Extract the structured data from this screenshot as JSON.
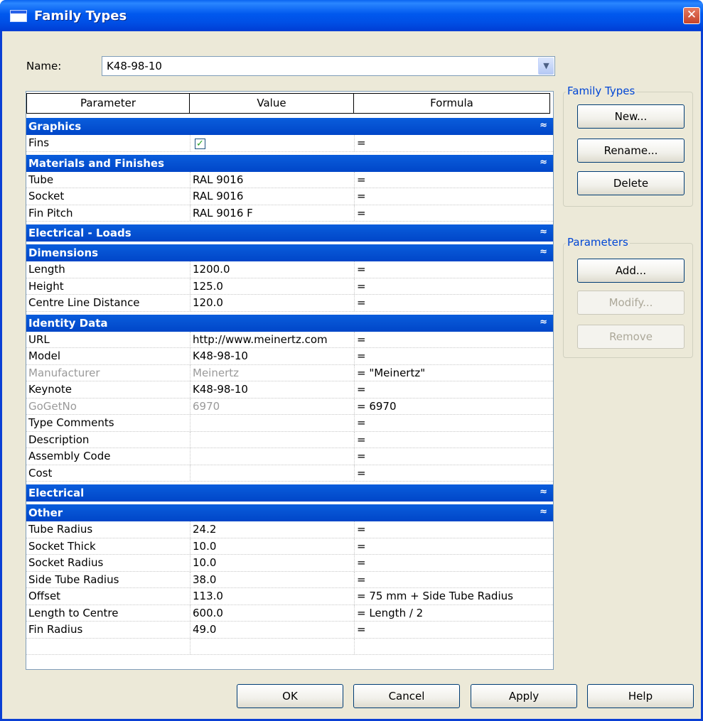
{
  "window": {
    "title": "Family Types",
    "close_glyph": "✕"
  },
  "name_field": {
    "label": "Name:",
    "value": "K48-98-10"
  },
  "columns": [
    "Parameter",
    "Value",
    "Formula"
  ],
  "groups": {
    "graphics": {
      "title": "Graphics",
      "expanded": true,
      "rows": [
        {
          "param": "Fins",
          "value_type": "checkbox",
          "checked": true,
          "formula": "="
        }
      ]
    },
    "materials": {
      "title": "Materials and Finishes",
      "expanded": true,
      "rows": [
        {
          "param": "Tube",
          "value": "RAL 9016",
          "formula": "="
        },
        {
          "param": "Socket",
          "value": "RAL 9016",
          "formula": "="
        },
        {
          "param": "Fin Pitch",
          "value": "RAL 9016 F",
          "formula": "="
        }
      ]
    },
    "electrical_loads": {
      "title": "Electrical - Loads",
      "expanded": false
    },
    "dimensions": {
      "title": "Dimensions",
      "expanded": true,
      "rows": [
        {
          "param": "Length",
          "value": "1200.0",
          "formula": "="
        },
        {
          "param": "Height",
          "value": "125.0",
          "formula": "="
        },
        {
          "param": "Centre Line Distance",
          "value": "120.0",
          "formula": "="
        }
      ]
    },
    "identity": {
      "title": "Identity Data",
      "expanded": true,
      "rows": [
        {
          "param": "URL",
          "value": "http://www.meinertz.com",
          "formula": "="
        },
        {
          "param": "Model",
          "value": "K48-98-10",
          "formula": "="
        },
        {
          "param": "Manufacturer",
          "value": "Meinertz",
          "formula": "= \"Meinertz\""
        },
        {
          "param": "Keynote",
          "value": "K48-98-10",
          "formula": "="
        },
        {
          "param": "GoGetNo",
          "value": "6970",
          "formula": "= 6970"
        },
        {
          "param": "Type Comments",
          "value": "",
          "formula": "="
        },
        {
          "param": "Description",
          "value": "",
          "formula": "="
        },
        {
          "param": "Assembly Code",
          "value": "",
          "formula": "="
        },
        {
          "param": "Cost",
          "value": "",
          "formula": "="
        }
      ]
    },
    "electrical": {
      "title": "Electrical",
      "expanded": false
    },
    "other": {
      "title": "Other",
      "expanded": true,
      "rows": [
        {
          "param": "Tube Radius",
          "value": "24.2",
          "formula": "="
        },
        {
          "param": "Socket Thick",
          "value": "10.0",
          "formula": "="
        },
        {
          "param": "Socket Radius",
          "value": "10.0",
          "formula": "="
        },
        {
          "param": "Side Tube Radius",
          "value": "38.0",
          "formula": "="
        },
        {
          "param": "Offset",
          "value": "113.0",
          "formula": "= 75 mm + Side Tube Radius"
        },
        {
          "param": "Length to Centre",
          "value": "600.0",
          "formula": "= Length / 2"
        },
        {
          "param": "Fin Radius",
          "value": "49.0",
          "formula": "="
        }
      ]
    }
  },
  "glyphs": {
    "collapse": "≈",
    "expand": "≈",
    "check": "✓",
    "dropdown": "▼"
  },
  "family_types_box": {
    "label": "Family Types",
    "new": "New...",
    "rename": "Rename...",
    "delete": "Delete"
  },
  "parameters_box": {
    "label": "Parameters",
    "add": "Add...",
    "modify": "Modify...",
    "remove": "Remove"
  },
  "footer": {
    "ok": "OK",
    "cancel": "Cancel",
    "apply": "Apply",
    "help": "Help"
  }
}
